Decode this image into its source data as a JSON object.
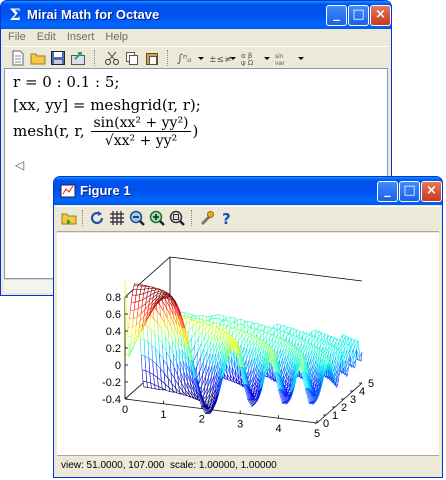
{
  "editor_window": {
    "title": "Mirai Math for Octave",
    "menu": [
      "File",
      "Edit",
      "Insert",
      "Help"
    ],
    "lines": {
      "line1": "r = 0 : 0.1 : 5;",
      "line2_lhs": "[xx, yy] = meshgrid(r, r);",
      "line3_prefix": "mesh(r, r,",
      "line3_num": "sin(xx² + yy²)",
      "line3_den": "√xx² + yy²",
      "line3_suffix": ")"
    }
  },
  "figure_window": {
    "title": "Figure 1",
    "status_text": "view: 51.0000, 107.000  scale: 1.00000, 1.00000"
  },
  "chart_data": {
    "type": "surface-mesh",
    "function": "sin(x^2+y^2)/sqrt(x^2+y^2)",
    "x_range": [
      0,
      5
    ],
    "y_range": [
      0,
      5
    ],
    "x_ticks": [
      "0",
      "1",
      "2",
      "3",
      "4",
      "5"
    ],
    "y_ticks": [
      "0",
      "1",
      "2",
      "3",
      "4",
      "5"
    ],
    "z_ticks": [
      "-0.4",
      "-0.2",
      "0",
      "0.2",
      "0.4",
      "0.6",
      "0.8"
    ],
    "zlim": [
      -0.4,
      0.8
    ],
    "view": [
      51,
      107
    ]
  },
  "colors": {
    "xp_title": "#0054e3",
    "xp_face": "#ece9d8",
    "accent_close": "#c8391e"
  }
}
